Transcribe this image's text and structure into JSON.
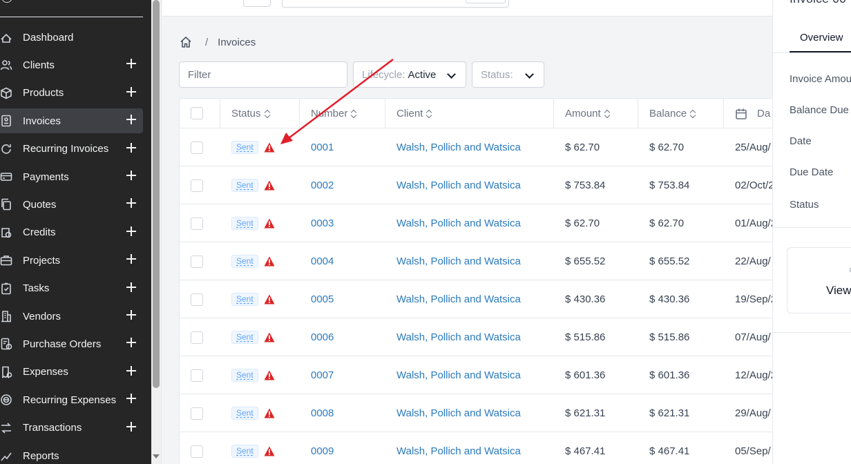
{
  "sidebar": {
    "items": [
      {
        "label": "Dashboard",
        "icon": "dashboard-icon",
        "plus": false,
        "active": false
      },
      {
        "label": "Clients",
        "icon": "users-icon",
        "plus": true,
        "active": false
      },
      {
        "label": "Products",
        "icon": "cube-icon",
        "plus": true,
        "active": false
      },
      {
        "label": "Invoices",
        "icon": "file-invoice-icon",
        "plus": true,
        "active": true
      },
      {
        "label": "Recurring Invoices",
        "icon": "refresh-icon",
        "plus": true,
        "active": false
      },
      {
        "label": "Payments",
        "icon": "credit-card-icon",
        "plus": true,
        "active": false
      },
      {
        "label": "Quotes",
        "icon": "copy-icon",
        "plus": true,
        "active": false
      },
      {
        "label": "Credits",
        "icon": "credit-icon",
        "plus": true,
        "active": false
      },
      {
        "label": "Projects",
        "icon": "briefcase-icon",
        "plus": true,
        "active": false
      },
      {
        "label": "Tasks",
        "icon": "clipboard-check-icon",
        "plus": true,
        "active": false
      },
      {
        "label": "Vendors",
        "icon": "building-icon",
        "plus": true,
        "active": false
      },
      {
        "label": "Purchase Orders",
        "icon": "purchase-order-icon",
        "plus": true,
        "active": false
      },
      {
        "label": "Expenses",
        "icon": "receipt-icon",
        "plus": true,
        "active": false
      },
      {
        "label": "Recurring Expenses",
        "icon": "recurring-expense-icon",
        "plus": true,
        "active": false
      },
      {
        "label": "Transactions",
        "icon": "transactions-icon",
        "plus": true,
        "active": false
      },
      {
        "label": "Reports",
        "icon": "chart-icon",
        "plus": false,
        "active": false
      }
    ]
  },
  "breadcrumb": {
    "current": "Invoices",
    "separator": "/"
  },
  "filters": {
    "filter_placeholder": "Filter",
    "lifecycle_label": "Lifecycle:",
    "lifecycle_value": "Active",
    "status_label": "Status:"
  },
  "table": {
    "headers": {
      "status": "Status",
      "number": "Number",
      "client": "Client",
      "amount": "Amount",
      "balance": "Balance",
      "date": "Da"
    },
    "rows": [
      {
        "status": "Sent",
        "number": "0001",
        "client": "Walsh, Pollich and Watsica",
        "amount": "$ 62.70",
        "balance": "$ 62.70",
        "date": "25/Aug/"
      },
      {
        "status": "Sent",
        "number": "0002",
        "client": "Walsh, Pollich and Watsica",
        "amount": "$ 753.84",
        "balance": "$ 753.84",
        "date": "02/Oct/2"
      },
      {
        "status": "Sent",
        "number": "0003",
        "client": "Walsh, Pollich and Watsica",
        "amount": "$ 62.70",
        "balance": "$ 62.70",
        "date": "01/Aug/2"
      },
      {
        "status": "Sent",
        "number": "0004",
        "client": "Walsh, Pollich and Watsica",
        "amount": "$ 655.52",
        "balance": "$ 655.52",
        "date": "22/Aug/"
      },
      {
        "status": "Sent",
        "number": "0005",
        "client": "Walsh, Pollich and Watsica",
        "amount": "$ 430.36",
        "balance": "$ 430.36",
        "date": "19/Sep/2"
      },
      {
        "status": "Sent",
        "number": "0006",
        "client": "Walsh, Pollich and Watsica",
        "amount": "$ 515.86",
        "balance": "$ 515.86",
        "date": "07/Aug/"
      },
      {
        "status": "Sent",
        "number": "0007",
        "client": "Walsh, Pollich and Watsica",
        "amount": "$ 601.36",
        "balance": "$ 601.36",
        "date": "12/Aug/2"
      },
      {
        "status": "Sent",
        "number": "0008",
        "client": "Walsh, Pollich and Watsica",
        "amount": "$ 621.31",
        "balance": "$ 621.31",
        "date": "29/Aug/"
      },
      {
        "status": "Sent",
        "number": "0009",
        "client": "Walsh, Pollich and Watsica",
        "amount": "$ 467.41",
        "balance": "$ 467.41",
        "date": "05/Sep/"
      }
    ]
  },
  "panel": {
    "title": "Invoice 00",
    "tab": "Overview",
    "labels": [
      "Invoice Amou",
      "Balance Due",
      "Date",
      "Due Date",
      "Status"
    ],
    "card_text": "View"
  },
  "colors": {
    "sidebar_bg": "#262626",
    "link": "#2b7abc",
    "badge_text": "#60a5fa",
    "warning": "#dc2626",
    "arrow": "#e11d2a"
  }
}
